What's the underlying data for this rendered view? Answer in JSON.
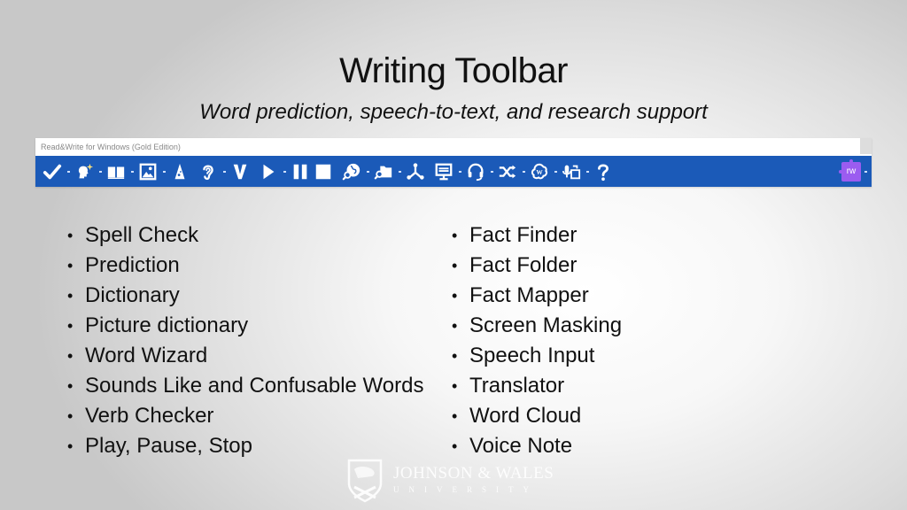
{
  "slide": {
    "title": "Writing Toolbar",
    "subtitle": "Word prediction, speech-to-text, and research support"
  },
  "app_window": {
    "title": "Read&Write for Windows (Gold Edition)",
    "toolbar_color": "#1b5ab8",
    "tools": [
      {
        "name": "Spell Check",
        "icon": "check-icon",
        "dropdown": true
      },
      {
        "name": "Prediction",
        "icon": "prediction-head-icon",
        "dropdown": true
      },
      {
        "name": "Dictionary",
        "icon": "book-icon",
        "dropdown": true
      },
      {
        "name": "Picture Dictionary",
        "icon": "picture-icon",
        "dropdown": true
      },
      {
        "name": "Word Wizard",
        "icon": "wizard-hat-icon",
        "dropdown": false
      },
      {
        "name": "Sounds Like and Confusable Words",
        "icon": "ear-icon",
        "dropdown": true
      },
      {
        "name": "Verb Checker",
        "icon": "verb-v-icon",
        "dropdown": false
      },
      {
        "name": "Play",
        "icon": "play-icon",
        "dropdown": true
      },
      {
        "name": "Pause",
        "icon": "pause-icon",
        "dropdown": false
      },
      {
        "name": "Stop",
        "icon": "stop-icon",
        "dropdown": false
      },
      {
        "name": "Fact Finder",
        "icon": "globe-search-icon",
        "dropdown": true
      },
      {
        "name": "Fact Folder",
        "icon": "folder-search-icon",
        "dropdown": true
      },
      {
        "name": "Fact Mapper",
        "icon": "nodes-icon",
        "dropdown": false
      },
      {
        "name": "Screen Masking",
        "icon": "monitor-icon",
        "dropdown": true
      },
      {
        "name": "Speech Input",
        "icon": "headset-icon",
        "dropdown": true
      },
      {
        "name": "Translator",
        "icon": "shuffle-icon",
        "dropdown": true
      },
      {
        "name": "Word Cloud",
        "icon": "word-cloud-icon",
        "dropdown": true
      },
      {
        "name": "Voice Note",
        "icon": "voice-note-icon",
        "dropdown": true
      },
      {
        "name": "Help",
        "icon": "help-icon",
        "dropdown": false
      }
    ],
    "extension": {
      "label": "rw",
      "color": "#9b5cf0"
    }
  },
  "lists": {
    "left": [
      "Spell Check",
      "Prediction",
      "Dictionary",
      "Picture dictionary",
      "Word Wizard",
      "Sounds Like and Confusable Words",
      "Verb Checker",
      "Play, Pause, Stop"
    ],
    "right": [
      "Fact Finder",
      "Fact Folder",
      "Fact Mapper",
      "Screen Masking",
      "Speech Input",
      "Translator",
      "Word Cloud",
      "Voice Note"
    ],
    "bullet": "•"
  },
  "logo": {
    "name": "JOHNSON & WALES",
    "sub": "UNIVERSITY"
  }
}
